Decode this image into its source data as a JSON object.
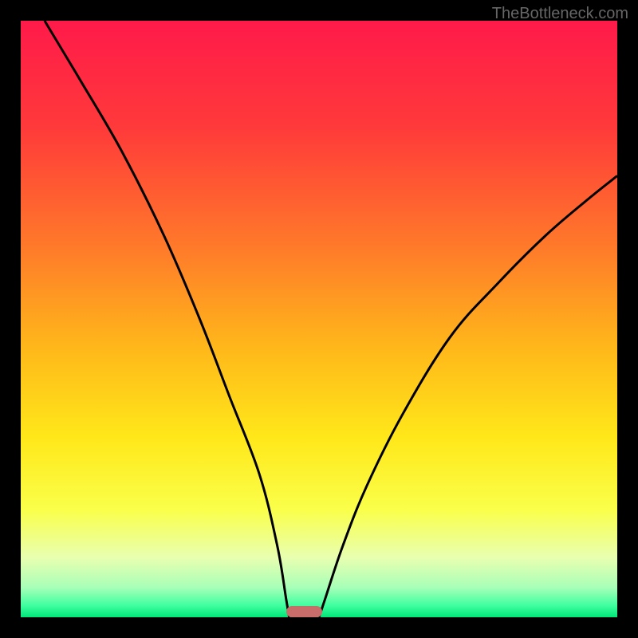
{
  "watermark": "TheBottleneck.com",
  "chart_data": {
    "type": "line",
    "title": "",
    "xlabel": "",
    "ylabel": "",
    "xlim": [
      0,
      100
    ],
    "ylim": [
      0,
      100
    ],
    "curve_left": {
      "description": "Left descending curve from top-left toward minimum",
      "points": [
        {
          "x": 4,
          "y": 100
        },
        {
          "x": 10,
          "y": 90
        },
        {
          "x": 17,
          "y": 78
        },
        {
          "x": 24,
          "y": 64
        },
        {
          "x": 30,
          "y": 50
        },
        {
          "x": 35,
          "y": 37
        },
        {
          "x": 40,
          "y": 24
        },
        {
          "x": 43,
          "y": 12
        },
        {
          "x": 44.5,
          "y": 3
        },
        {
          "x": 45,
          "y": 0
        }
      ]
    },
    "curve_right": {
      "description": "Right ascending curve from minimum toward upper-right",
      "points": [
        {
          "x": 50,
          "y": 0
        },
        {
          "x": 51,
          "y": 3
        },
        {
          "x": 54,
          "y": 12
        },
        {
          "x": 58,
          "y": 22
        },
        {
          "x": 64,
          "y": 34
        },
        {
          "x": 72,
          "y": 47
        },
        {
          "x": 80,
          "y": 56
        },
        {
          "x": 88,
          "y": 64
        },
        {
          "x": 95,
          "y": 70
        },
        {
          "x": 100,
          "y": 74
        }
      ]
    },
    "minimum_bar": {
      "x_start": 44.5,
      "x_end": 50.5,
      "color": "#c96d6b"
    },
    "gradient_stops": [
      {
        "offset": 0,
        "color": "#ff1a4a"
      },
      {
        "offset": 18,
        "color": "#ff3a3a"
      },
      {
        "offset": 38,
        "color": "#ff7a2a"
      },
      {
        "offset": 55,
        "color": "#ffb81a"
      },
      {
        "offset": 70,
        "color": "#ffe81a"
      },
      {
        "offset": 82,
        "color": "#faff4a"
      },
      {
        "offset": 90,
        "color": "#e8ffb0"
      },
      {
        "offset": 95,
        "color": "#a8ffb8"
      },
      {
        "offset": 98,
        "color": "#40ffa0"
      },
      {
        "offset": 100,
        "color": "#00e878"
      }
    ]
  }
}
